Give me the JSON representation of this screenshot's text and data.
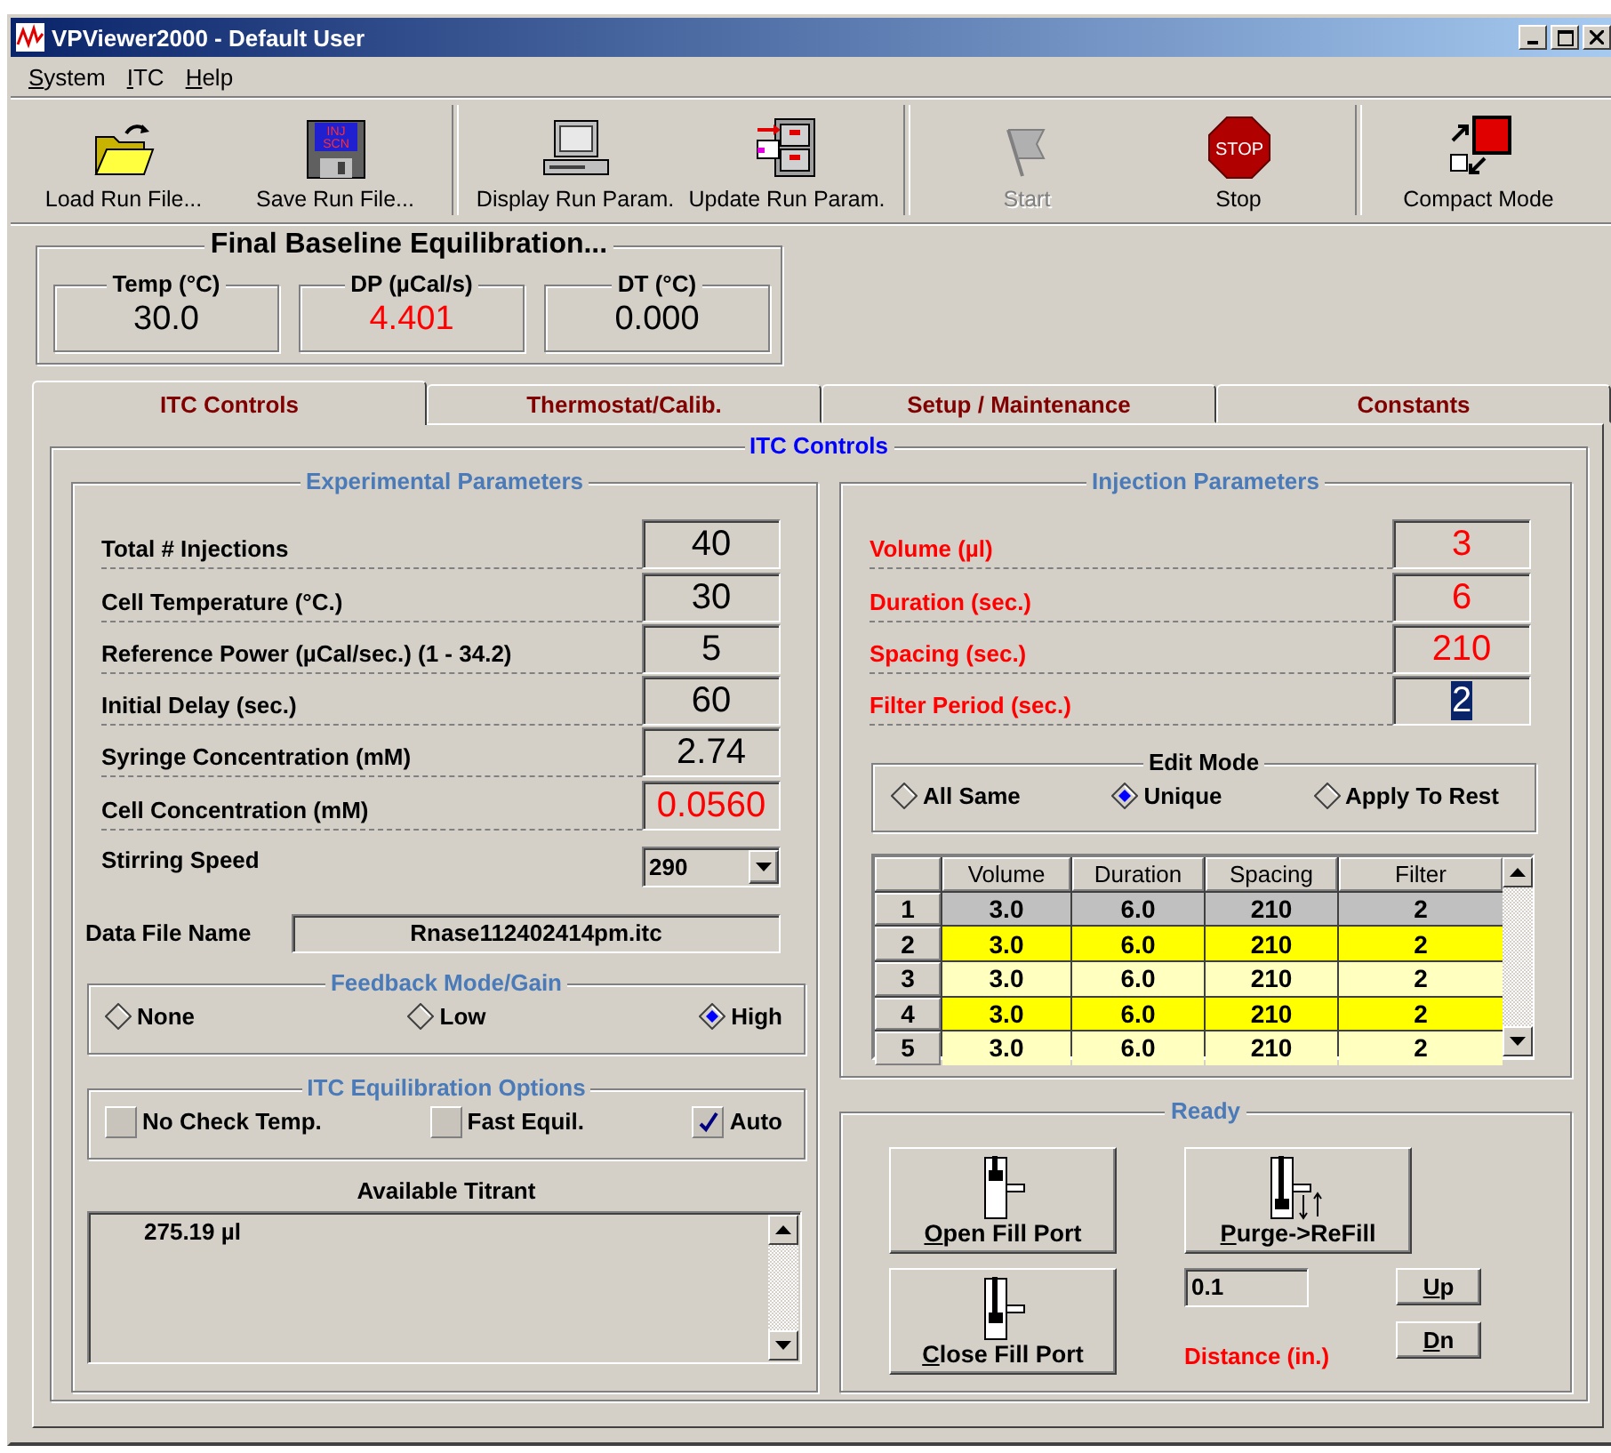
{
  "window": {
    "title": "VPViewer2000 - Default User"
  },
  "menu": [
    {
      "label": "System",
      "mnemonic": true
    },
    {
      "label": "ITC",
      "mnemonic": true
    },
    {
      "label": "Help",
      "mnemonic": true
    }
  ],
  "toolbar": [
    {
      "label": "Load Run File...",
      "disabled": false,
      "separator_before": false
    },
    {
      "label": "Save Run File...",
      "disabled": false,
      "separator_before": false,
      "icon_text": [
        "INJ",
        "SCN"
      ]
    },
    {
      "label": "Display Run Param.",
      "disabled": false,
      "separator_before": true
    },
    {
      "label": "Update Run Param.",
      "disabled": false,
      "separator_before": false
    },
    {
      "label": "Start",
      "disabled": true,
      "separator_before": true
    },
    {
      "label": "Stop",
      "disabled": false,
      "separator_before": false,
      "icon_text": [
        "STOP"
      ]
    },
    {
      "label": "Compact Mode",
      "disabled": false,
      "separator_before": true
    }
  ],
  "status": {
    "title": "Final Baseline Equilibration...",
    "readouts": [
      {
        "label": "Temp (°C)",
        "value": "30.0",
        "alert": false
      },
      {
        "label": "DP (µCal/s)",
        "value": "4.401",
        "alert": true
      },
      {
        "label": "DT (°C)",
        "value": "0.000",
        "alert": false
      }
    ]
  },
  "tabs": [
    {
      "label": "ITC Controls",
      "selected": true
    },
    {
      "label": "Thermostat/Calib.",
      "selected": false
    },
    {
      "label": "Setup / Maintenance",
      "selected": false
    },
    {
      "label": "Constants",
      "selected": false
    }
  ],
  "panel": {
    "title": "ITC Controls",
    "experimental": {
      "title": "Experimental Parameters",
      "labels_alert": false,
      "params": [
        {
          "label": "Total # Injections",
          "value": "40",
          "alert": false,
          "focused": false
        },
        {
          "label": "Cell Temperature (°C.)",
          "value": "30",
          "alert": false,
          "focused": false
        },
        {
          "label": "Reference Power (µCal/sec.) (1 - 34.2)",
          "value": "5",
          "alert": false,
          "focused": false
        },
        {
          "label": "Initial Delay (sec.)",
          "value": "60",
          "alert": false,
          "focused": false
        },
        {
          "label": "Syringe Concentration (mM)",
          "value": "2.74",
          "alert": false,
          "focused": false
        },
        {
          "label": "Cell Concentration (mM)",
          "value": "0.0560",
          "alert": true,
          "focused": false
        }
      ],
      "stirring": {
        "label": "Stirring Speed",
        "value": "290"
      },
      "data_file": {
        "label": "Data File Name",
        "value": "Rnase112402414pm.itc"
      },
      "feedback": {
        "title": "Feedback Mode/Gain",
        "options": [
          {
            "label": "None",
            "selected": false
          },
          {
            "label": "Low",
            "selected": false
          },
          {
            "label": "High",
            "selected": true
          }
        ]
      },
      "equilibration": {
        "title": "ITC Equilibration Options",
        "options": [
          {
            "label": "No Check Temp.",
            "checked": false
          },
          {
            "label": "Fast Equil.",
            "checked": false
          },
          {
            "label": "Auto",
            "checked": true
          }
        ]
      },
      "titrant": {
        "label": "Available Titrant",
        "value": "275.19 µl"
      }
    },
    "injection": {
      "title": "Injection Parameters",
      "labels_alert": true,
      "params": [
        {
          "label": "Volume (µl)",
          "value": "3",
          "alert": true,
          "focused": false
        },
        {
          "label": "Duration (sec.)",
          "value": "6",
          "alert": true,
          "focused": false
        },
        {
          "label": "Spacing (sec.)",
          "value": "210",
          "alert": true,
          "focused": false
        },
        {
          "label": "Filter Period (sec.)",
          "value": "2",
          "alert": false,
          "focused": true
        }
      ],
      "edit_mode": {
        "title": "Edit Mode",
        "options": [
          {
            "label": "All Same",
            "selected": false
          },
          {
            "label": "Unique",
            "selected": true
          },
          {
            "label": "Apply To Rest",
            "selected": false
          }
        ]
      },
      "table": {
        "columns": [
          "Volume",
          "Duration",
          "Spacing",
          "Filter"
        ],
        "rows": [
          {
            "number": "1",
            "cells": [
              "3.0",
              "6.0",
              "210",
              "2"
            ],
            "selected": true
          },
          {
            "number": "2",
            "cells": [
              "3.0",
              "6.0",
              "210",
              "2"
            ],
            "selected": false
          },
          {
            "number": "3",
            "cells": [
              "3.0",
              "6.0",
              "210",
              "2"
            ],
            "selected": false
          },
          {
            "number": "4",
            "cells": [
              "3.0",
              "6.0",
              "210",
              "2"
            ],
            "selected": false
          },
          {
            "number": "5",
            "cells": [
              "3.0",
              "6.0",
              "210",
              "2"
            ],
            "selected": false
          }
        ]
      }
    },
    "ready": {
      "title": "Ready",
      "buttons": [
        {
          "label": "Open Fill Port",
          "mnemonic": true
        },
        {
          "label": "Purge->ReFill",
          "mnemonic": true
        },
        {
          "label": "Close Fill Port",
          "mnemonic": true
        }
      ],
      "distance": {
        "value": "0.1",
        "label": "Distance (in.)",
        "alert": true
      },
      "steps": [
        {
          "label": "Up",
          "mnemonic": true
        },
        {
          "label": "Dn",
          "mnemonic": true
        }
      ]
    }
  }
}
